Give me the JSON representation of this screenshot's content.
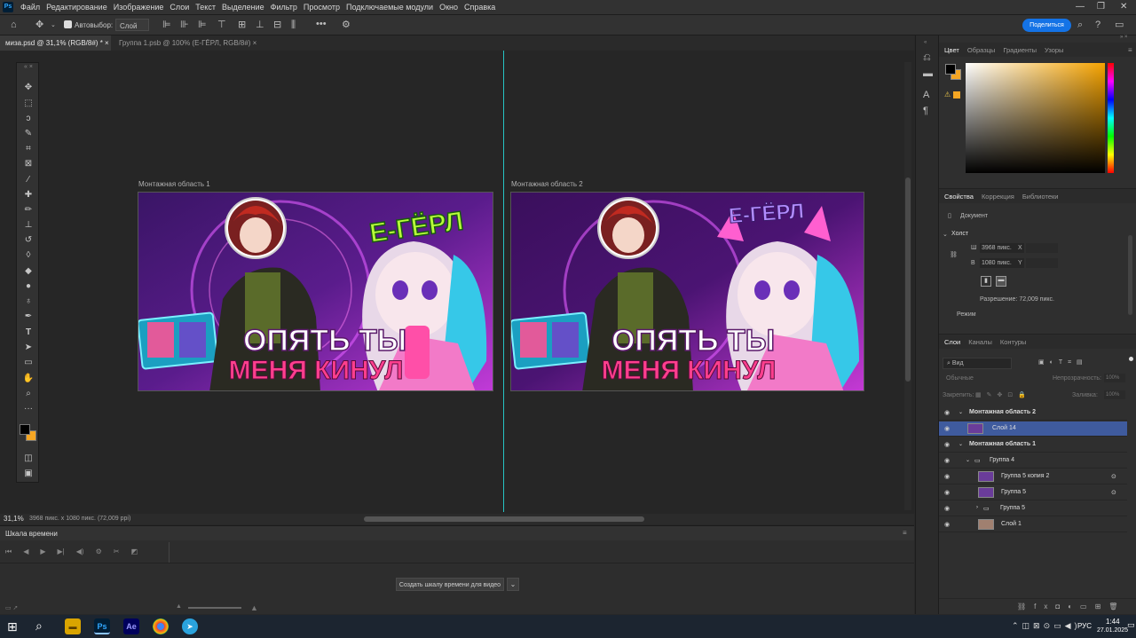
{
  "app": {
    "logo": "Ps"
  },
  "menu": [
    "Файл",
    "Редактирование",
    "Изображение",
    "Слои",
    "Текст",
    "Выделение",
    "Фильтр",
    "Просмотр",
    "Подключаемые модули",
    "Окно",
    "Справка"
  ],
  "options": {
    "autoselect_label": "Автовыбор:",
    "autoselect_value": "Слой",
    "share_label": "Поделиться"
  },
  "tabs": [
    {
      "label": "миза.psd @ 31,1% (RGB/8#) *",
      "close": "×"
    },
    {
      "label": "Группа 1.psb @ 100% (Е-ГЁРЛ, RGB/8#)",
      "close": "×"
    }
  ],
  "artboards": [
    {
      "label": "Монтажная область 1",
      "title1": "ОПЯТЬ ТЫ",
      "title2": "МЕНЯ КИНУЛ",
      "badge": "Е-ГЁРЛ"
    },
    {
      "label": "Монтажная область 2",
      "title1": "ОПЯТЬ ТЫ",
      "title2": "МЕНЯ КИНУЛ",
      "badge": "Е-ГЁРЛ"
    }
  ],
  "status": {
    "zoom": "31,1%",
    "info": "3968 пикс. x 1080 пикс. (72,009 ppi)"
  },
  "timeline": {
    "title": "Шкала времени",
    "create_button": "Создать шкалу времени для видео"
  },
  "color_panel": {
    "tabs": [
      "Цвет",
      "Образцы",
      "Градиенты",
      "Узоры"
    ],
    "fg": "#000000",
    "bg": "#f5a623"
  },
  "properties": {
    "tabs": [
      "Свойства",
      "Коррекция",
      "Библиотеки"
    ],
    "doc_label": "Документ",
    "section": "Холст",
    "w_label": "Ш",
    "w_value": "3968 пикс.",
    "x_label": "X",
    "h_label": "В",
    "h_value": "1080 пикс.",
    "y_label": "Y",
    "resolution": "Разрешение: 72,009 пикс.",
    "mode": "Режим"
  },
  "layers_panel": {
    "tabs": [
      "Слои",
      "Каналы",
      "Контуры"
    ],
    "filter": "Вид",
    "blend": "Обычные",
    "opacity_label": "Непрозрачность:",
    "opacity": "100%",
    "lock_label": "Закрепить:",
    "fill_label": "Заливка:",
    "fill": "100%",
    "layers": [
      {
        "name": "Монтажная область 2",
        "kind": "artboard"
      },
      {
        "name": "Слой 14",
        "kind": "layer",
        "selected": true
      },
      {
        "name": "Монтажная область 1",
        "kind": "artboard"
      },
      {
        "name": "Группа 4",
        "kind": "group"
      },
      {
        "name": "Группа 5 копия 2",
        "kind": "smart"
      },
      {
        "name": "Группа 5",
        "kind": "smart"
      },
      {
        "name": "Группа 5",
        "kind": "group"
      },
      {
        "name": "Слой 1",
        "kind": "layer"
      }
    ]
  },
  "taskbar": {
    "time": "1:44",
    "date": "27.01.2025",
    "lang": "РУС"
  },
  "colors": {
    "accent": "#1473e6",
    "ps_bg": "#001e36",
    "ps_fg": "#31a8ff",
    "ae_bg": "#00005b",
    "ae_fg": "#9999ff",
    "selected_layer": "#3f5b9e"
  }
}
